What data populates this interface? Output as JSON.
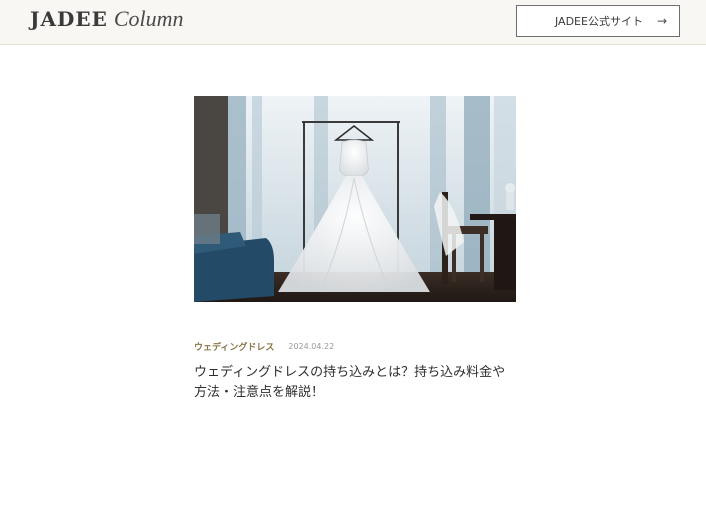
{
  "header": {
    "logo_main": "JADEE",
    "logo_sub": "Column",
    "site_link_label": "JADEE公式サイト",
    "site_link_icon": "arrow-right-icon"
  },
  "article": {
    "image_subject": "wedding-dress-photo",
    "category": "ウェディングドレス",
    "date": "2024.04.22",
    "title_line1": "ウェディングドレスの持ち込みとは？持ち込み料金や",
    "title_line2": "方法・注意点を解説！"
  },
  "colors": {
    "header_bg": "#f8f7f3",
    "category_color": "#8a7446",
    "border": "#6f6f6f"
  }
}
